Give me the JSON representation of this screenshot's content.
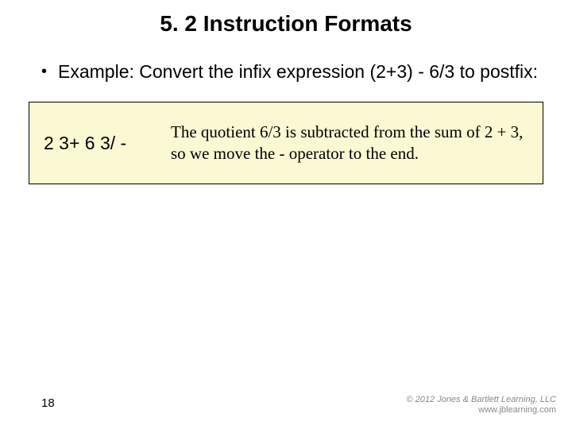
{
  "title": "5. 2 Instruction Formats",
  "bullet": {
    "marker": "•",
    "text": "Example: Convert the infix expression (2+3) - 6/3 to postfix:"
  },
  "box": {
    "postfix": "2 3+ 6 3/ -",
    "explanation": "The quotient 6/3 is subtracted from the sum of 2 + 3, so we move the - operator to the end."
  },
  "page_number": "18",
  "copyright": {
    "line1": "© 2012 Jones & Bartlett Learning, LLC",
    "line2": "www.jblearning.com"
  }
}
